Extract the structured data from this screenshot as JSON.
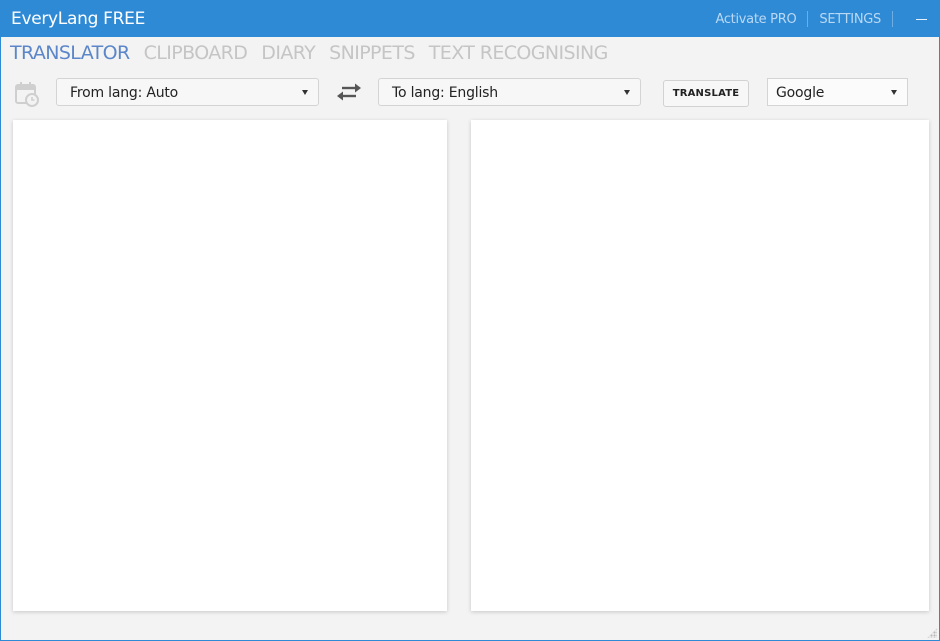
{
  "window": {
    "title": "EveryLang FREE",
    "activate_pro": "Activate PRO",
    "settings": "SETTINGS",
    "minimize_icon": "minimize-icon"
  },
  "tabs": [
    {
      "label": "TRANSLATOR",
      "active": true
    },
    {
      "label": "CLIPBOARD",
      "active": false
    },
    {
      "label": "DIARY",
      "active": false
    },
    {
      "label": "SNIPPETS",
      "active": false
    },
    {
      "label": "TEXT RECOGNISING",
      "active": false
    }
  ],
  "toolbar": {
    "history_icon": "calendar-clock-icon",
    "from_lang": "From lang: Auto",
    "swap_icon": "swap-arrows-icon",
    "to_lang": "To lang: English",
    "translate_label": "TRANSLATE",
    "engine": "Google"
  },
  "panels": {
    "source_text": "",
    "result_text": ""
  },
  "colors": {
    "accent": "#2f8ad6",
    "active_tab": "#5b86c9",
    "inactive_tab": "#c5c5c5"
  }
}
